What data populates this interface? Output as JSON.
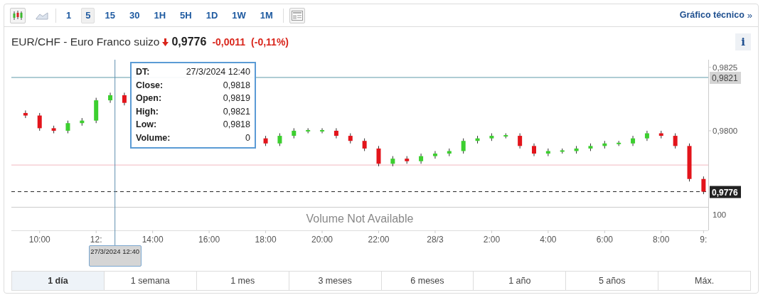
{
  "toolbar": {
    "chart_types": [
      {
        "kind": "candles",
        "selected": true
      },
      {
        "kind": "area",
        "selected": false
      }
    ],
    "intervals": [
      {
        "label": "1",
        "selected": false
      },
      {
        "label": "5",
        "selected": true
      },
      {
        "label": "15",
        "selected": false
      },
      {
        "label": "30",
        "selected": false
      },
      {
        "label": "1H",
        "selected": false
      },
      {
        "label": "5H",
        "selected": false
      },
      {
        "label": "1D",
        "selected": false
      },
      {
        "label": "1W",
        "selected": false
      },
      {
        "label": "1M",
        "selected": false
      }
    ],
    "technical_link": "Gráfico técnico",
    "technical_link_arrow": "»"
  },
  "header": {
    "title": "EUR/CHF - Euro Franco suizo",
    "falling": true,
    "price": "0,9776",
    "change": "-0,0011",
    "change_percent": "(-0,11%)",
    "info_button": "i"
  },
  "chart": {
    "chart_data": {
      "type": "candlestick",
      "ylim": [
        0.977,
        0.9828
      ],
      "xlim": [
        "2024-03-27 09:00",
        "2024-03-28 09:40"
      ],
      "x": [
        "2024-03-27 09:30",
        "2024-03-27 10:00",
        "2024-03-27 10:30",
        "2024-03-27 11:00",
        "2024-03-27 11:30",
        "2024-03-27 12:00",
        "2024-03-27 12:30",
        "2024-03-27 13:00",
        "2024-03-27 18:00",
        "2024-03-27 18:30",
        "2024-03-27 19:00",
        "2024-03-27 19:30",
        "2024-03-27 20:00",
        "2024-03-27 20:30",
        "2024-03-27 21:00",
        "2024-03-27 21:30",
        "2024-03-27 22:00",
        "2024-03-27 22:30",
        "2024-03-27 23:00",
        "2024-03-27 23:30",
        "2024-03-28 00:00",
        "2024-03-28 00:30",
        "2024-03-28 01:00",
        "2024-03-28 01:30",
        "2024-03-28 02:00",
        "2024-03-28 02:30",
        "2024-03-28 03:00",
        "2024-03-28 03:30",
        "2024-03-28 04:00",
        "2024-03-28 04:30",
        "2024-03-28 05:00",
        "2024-03-28 05:30",
        "2024-03-28 06:00",
        "2024-03-28 06:30",
        "2024-03-28 07:00",
        "2024-03-28 07:30",
        "2024-03-28 08:00",
        "2024-03-28 08:30",
        "2024-03-28 09:00",
        "2024-03-28 09:30"
      ],
      "ohlc": [
        [
          0.9807,
          0.9808,
          0.9805,
          0.9806
        ],
        [
          0.9806,
          0.9807,
          0.98,
          0.9801
        ],
        [
          0.9801,
          0.9802,
          0.9799,
          0.98
        ],
        [
          0.98,
          0.9804,
          0.9799,
          0.9803
        ],
        [
          0.9803,
          0.9805,
          0.9802,
          0.9804
        ],
        [
          0.9804,
          0.9813,
          0.9803,
          0.9812
        ],
        [
          0.9812,
          0.9815,
          0.9811,
          0.9814
        ],
        [
          0.9814,
          0.9815,
          0.981,
          0.9811
        ],
        [
          0.9797,
          0.9798,
          0.9794,
          0.9795
        ],
        [
          0.9795,
          0.9799,
          0.9794,
          0.9798
        ],
        [
          0.9798,
          0.9801,
          0.9797,
          0.98
        ],
        [
          0.98,
          0.9801,
          0.9799,
          0.98
        ],
        [
          0.98,
          0.9801,
          0.9799,
          0.98
        ],
        [
          0.98,
          0.9801,
          0.9797,
          0.9798
        ],
        [
          0.9798,
          0.9799,
          0.9795,
          0.9796
        ],
        [
          0.9796,
          0.9797,
          0.9792,
          0.9793
        ],
        [
          0.9793,
          0.9794,
          0.9786,
          0.9787
        ],
        [
          0.9787,
          0.979,
          0.9786,
          0.9789
        ],
        [
          0.9789,
          0.979,
          0.9787,
          0.9788
        ],
        [
          0.9788,
          0.9791,
          0.9787,
          0.979
        ],
        [
          0.979,
          0.9792,
          0.9789,
          0.9791
        ],
        [
          0.9791,
          0.9793,
          0.979,
          0.9792
        ],
        [
          0.9792,
          0.9797,
          0.9791,
          0.9796
        ],
        [
          0.9796,
          0.9798,
          0.9795,
          0.9797
        ],
        [
          0.9797,
          0.9799,
          0.9796,
          0.9798
        ],
        [
          0.9798,
          0.9799,
          0.9797,
          0.9798
        ],
        [
          0.9798,
          0.9799,
          0.9793,
          0.9794
        ],
        [
          0.9794,
          0.9795,
          0.979,
          0.9791
        ],
        [
          0.9791,
          0.9793,
          0.979,
          0.9792
        ],
        [
          0.9792,
          0.9793,
          0.9791,
          0.9792
        ],
        [
          0.9792,
          0.9794,
          0.9791,
          0.9793
        ],
        [
          0.9793,
          0.9795,
          0.9792,
          0.9794
        ],
        [
          0.9794,
          0.9796,
          0.9793,
          0.9795
        ],
        [
          0.9795,
          0.9796,
          0.9794,
          0.9795
        ],
        [
          0.9795,
          0.9798,
          0.9794,
          0.9797
        ],
        [
          0.9797,
          0.98,
          0.9796,
          0.9799
        ],
        [
          0.9799,
          0.98,
          0.9797,
          0.9798
        ],
        [
          0.9798,
          0.9799,
          0.9793,
          0.9794
        ],
        [
          0.9794,
          0.9795,
          0.978,
          0.9781
        ],
        [
          0.9781,
          0.9782,
          0.9775,
          0.9776
        ]
      ],
      "yticks": [
        {
          "value": 0.9825,
          "label": "0,9825"
        },
        {
          "value": 0.98,
          "label": "0,9800"
        }
      ],
      "xticks": [
        {
          "value": "2024-03-27 10:00",
          "label": "10:00"
        },
        {
          "value": "2024-03-27 12:00",
          "label": "12:"
        },
        {
          "value": "2024-03-27 14:00",
          "label": "14:00"
        },
        {
          "value": "2024-03-27 16:00",
          "label": "16:00"
        },
        {
          "value": "2024-03-27 18:00",
          "label": "18:00"
        },
        {
          "value": "2024-03-27 20:00",
          "label": "20:00"
        },
        {
          "value": "2024-03-27 22:00",
          "label": "22:00"
        },
        {
          "value": "2024-03-28 00:00",
          "label": "28/3"
        },
        {
          "value": "2024-03-28 02:00",
          "label": "2:00"
        },
        {
          "value": "2024-03-28 04:00",
          "label": "4:00"
        },
        {
          "value": "2024-03-28 06:00",
          "label": "6:00"
        },
        {
          "value": "2024-03-28 08:00",
          "label": "8:00"
        },
        {
          "value": "2024-03-28 09:30",
          "label": "9:"
        }
      ],
      "ref_lines": [
        {
          "axis": "y",
          "value": 0.97865,
          "color": "#f2b8c0"
        },
        {
          "axis": "y",
          "value": 0.9776,
          "label": "0,9776",
          "color": "#222222"
        },
        {
          "axis": "y",
          "value": 0.9821,
          "label": "0,9821",
          "color": "#5f9aa8"
        },
        {
          "axis": "x",
          "value": "2024-03-27 12:40",
          "label": "27/3/2024 12:40",
          "color": "#5f8fb0"
        }
      ]
    },
    "tooltip": [
      {
        "label": "DT:",
        "value": "27/3/2024 12:40"
      },
      {
        "label": "Close:",
        "value": "0,9818"
      },
      {
        "label": "Open:",
        "value": "0,9819"
      },
      {
        "label": "High:",
        "value": "0,9821"
      },
      {
        "label": "Low:",
        "value": "0,9818"
      },
      {
        "label": "Volume:",
        "value": "0"
      }
    ],
    "volume_pane": {
      "message": "Volume Not Available",
      "axis_label": "100"
    }
  },
  "ranges": [
    {
      "label": "1 día",
      "selected": true
    },
    {
      "label": "1 semana",
      "selected": false
    },
    {
      "label": "1 mes",
      "selected": false
    },
    {
      "label": "3 meses",
      "selected": false
    },
    {
      "label": "6 meses",
      "selected": false
    },
    {
      "label": "1 año",
      "selected": false
    },
    {
      "label": "5 años",
      "selected": false
    },
    {
      "label": "Máx.",
      "selected": false
    }
  ]
}
